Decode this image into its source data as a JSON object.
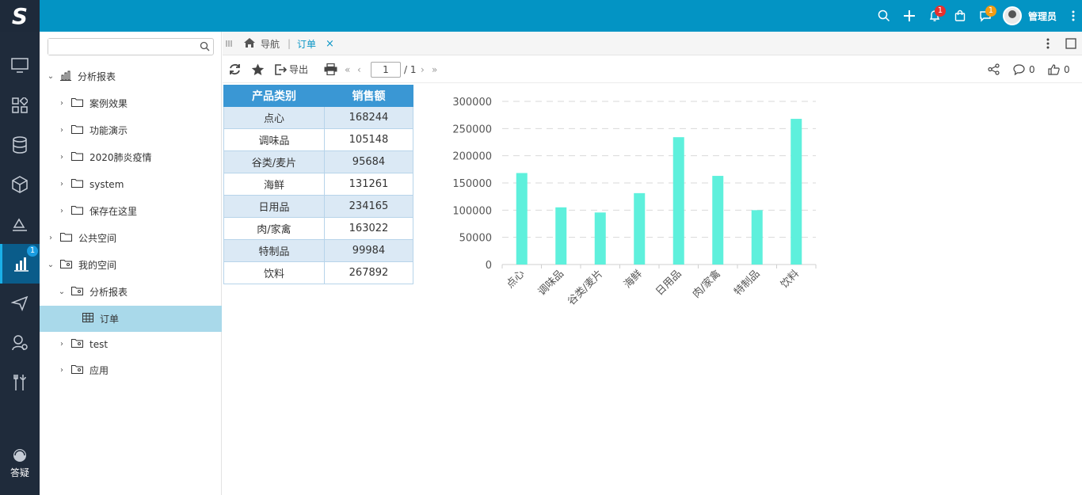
{
  "topbar": {
    "username": "管理员",
    "notification_badge": "1",
    "message_badge": "1"
  },
  "rail": {
    "active_badge": "1",
    "help_label": "答疑"
  },
  "tree": {
    "search_placeholder": "",
    "nodes": [
      {
        "label": "分析报表"
      },
      {
        "label": "案例效果"
      },
      {
        "label": "功能演示"
      },
      {
        "label": "2020肺炎疫情"
      },
      {
        "label": "system"
      },
      {
        "label": "保存在这里"
      },
      {
        "label": "公共空间"
      },
      {
        "label": "我的空间"
      },
      {
        "label": "分析报表"
      },
      {
        "label": "订单"
      },
      {
        "label": "test"
      },
      {
        "label": "应用"
      }
    ]
  },
  "breadcrumb": {
    "nav_label": "导航",
    "tab_label": "订单"
  },
  "toolbar": {
    "export_label": "导出",
    "page_value": "1",
    "page_total": "/ 1",
    "comment_count": "0",
    "like_count": "0"
  },
  "table": {
    "headers": [
      "产品类别",
      "销售额"
    ],
    "rows": [
      [
        "点心",
        "168244"
      ],
      [
        "调味品",
        "105148"
      ],
      [
        "谷类/麦片",
        "95684"
      ],
      [
        "海鲜",
        "131261"
      ],
      [
        "日用品",
        "234165"
      ],
      [
        "肉/家禽",
        "163022"
      ],
      [
        "特制品",
        "99984"
      ],
      [
        "饮料",
        "267892"
      ]
    ]
  },
  "chart_data": {
    "type": "bar",
    "categories": [
      "点心",
      "调味品",
      "谷类/麦片",
      "海鲜",
      "日用品",
      "肉/家禽",
      "特制品",
      "饮料"
    ],
    "values": [
      168244,
      105148,
      95684,
      131261,
      234165,
      163022,
      99984,
      267892
    ],
    "ylim": [
      0,
      300000
    ],
    "yticks": [
      "0",
      "50000",
      "100000",
      "150000",
      "200000",
      "250000",
      "300000"
    ],
    "bar_color": "#5ef0dc",
    "grid": true
  },
  "colors": {
    "topbar": "#0394c4",
    "rail": "#1f2b3b",
    "accent": "#0a96c6",
    "table_header": "#3a97d4"
  }
}
